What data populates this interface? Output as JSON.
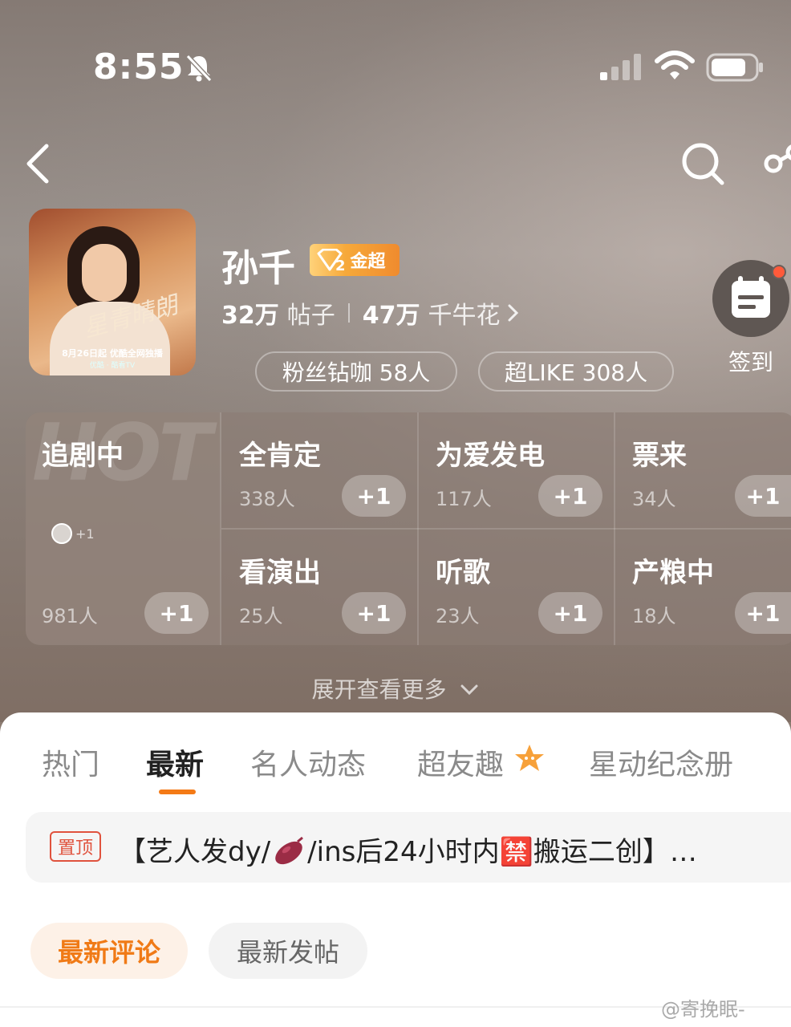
{
  "status_bar": {
    "time": "8:55",
    "icons": [
      "bell-off-icon",
      "signal-icon",
      "wifi-icon",
      "battery-icon"
    ]
  },
  "nav": {
    "icons": [
      "back-icon",
      "search-icon",
      "share-icon"
    ]
  },
  "profile": {
    "name": "孙千",
    "badge": {
      "level": "2",
      "label": "金超",
      "color": "#f39a33"
    },
    "posts_count": "32万",
    "posts_label": "帖子",
    "flowers_count": "47万",
    "flowers_label": "千牛花",
    "pills": {
      "fans": "粉丝钻咖 58人",
      "like": "超LIKE 308人"
    },
    "checkin_label": "签到",
    "avatar_poster": {
      "date_line": "8月26日起 优酷全网独播",
      "sub_line": "优酷 · 酷看TV",
      "title": "星青晴朗"
    }
  },
  "activities": {
    "hot": {
      "watermark": "HOT",
      "title": "追剧中",
      "count": "981人",
      "avatar_plus": "+1",
      "plus": "+1"
    },
    "items": [
      {
        "title": "全肯定",
        "count": "338人",
        "plus": "+1"
      },
      {
        "title": "为爱发电",
        "count": "117人",
        "plus": "+1"
      },
      {
        "title": "票来",
        "count": "34人",
        "plus": "+1"
      },
      {
        "title": "看演出",
        "count": "25人",
        "plus": "+1"
      },
      {
        "title": "听歌",
        "count": "23人",
        "plus": "+1"
      },
      {
        "title": "产粮中",
        "count": "18人",
        "plus": "+1"
      }
    ],
    "expand_label": "展开查看更多"
  },
  "tabs": [
    {
      "label": "热门",
      "active": false
    },
    {
      "label": "最新",
      "active": true
    },
    {
      "label": "名人动态",
      "active": false
    },
    {
      "label": "超友趣",
      "active": false
    },
    {
      "label": "星动纪念册",
      "active": false
    }
  ],
  "accent_color": "#f47a16",
  "pinned": {
    "tag": "置顶",
    "text_before": "【艺人发dy/",
    "text_after": "/ins后24小时内🈲搬运二创】…"
  },
  "sort_buttons": {
    "new_comment": "最新评论",
    "new_post": "最新发帖"
  },
  "watermark": "@寄挽眠-"
}
